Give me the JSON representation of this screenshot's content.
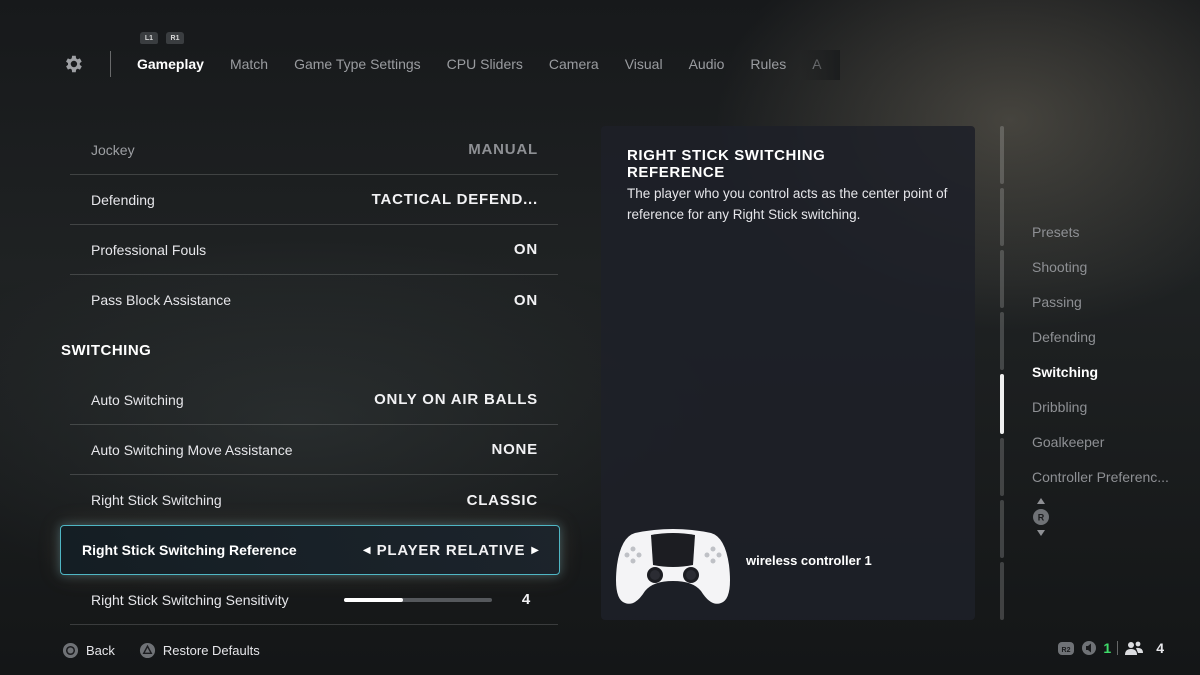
{
  "nav": {
    "bumpers": [
      "L1",
      "R1"
    ],
    "tabs": [
      "Gameplay",
      "Match",
      "Game Type Settings",
      "CPU Sliders",
      "Camera",
      "Visual",
      "Audio",
      "Rules",
      "A"
    ],
    "active_tab": "Gameplay"
  },
  "settings": {
    "rows_top": [
      {
        "label": "Jockey",
        "value": "MANUAL"
      },
      {
        "label": "Defending",
        "value": "TACTICAL DEFEND..."
      },
      {
        "label": "Professional Fouls",
        "value": "ON"
      },
      {
        "label": "Pass Block Assistance",
        "value": "ON"
      }
    ],
    "section_title": "SWITCHING",
    "rows_switching": [
      {
        "label": "Auto Switching",
        "value": "ONLY ON AIR BALLS"
      },
      {
        "label": "Auto Switching Move Assistance",
        "value": "NONE"
      },
      {
        "label": "Right Stick Switching",
        "value": "CLASSIC"
      }
    ],
    "selected": {
      "label": "Right Stick Switching Reference",
      "value": "PLAYER RELATIVE",
      "left_arrow": "◀",
      "right_arrow": "▶"
    },
    "sensitivity": {
      "label": "Right Stick Switching Sensitivity",
      "value": "4",
      "level_fraction": 0.4
    }
  },
  "info": {
    "title": "RIGHT STICK SWITCHING REFERENCE",
    "description": "The player who you control acts as the center point of reference for any Right Stick switching.",
    "controller_label": "wireless controller 1"
  },
  "sidebar": {
    "items": [
      "Presets",
      "Shooting",
      "Passing",
      "Defending",
      "Switching",
      "Dribbling",
      "Goalkeeper",
      "Controller Preferenc..."
    ],
    "active": "Switching",
    "rstick_label": "R"
  },
  "footer": {
    "back_label": "Back",
    "restore_label": "Restore Defaults",
    "r2_label": "R2",
    "count_green": "1",
    "players_count": "4"
  },
  "colors": {
    "accent_cyan": "#4fb6c4",
    "status_green": "#3fdc6a",
    "panel_bg": "#1e2028"
  },
  "icons": [
    "gear-icon",
    "circle-button-icon",
    "triangle-button-icon",
    "r2-icon",
    "speaker-icon",
    "players-icon",
    "controller-icon"
  ]
}
